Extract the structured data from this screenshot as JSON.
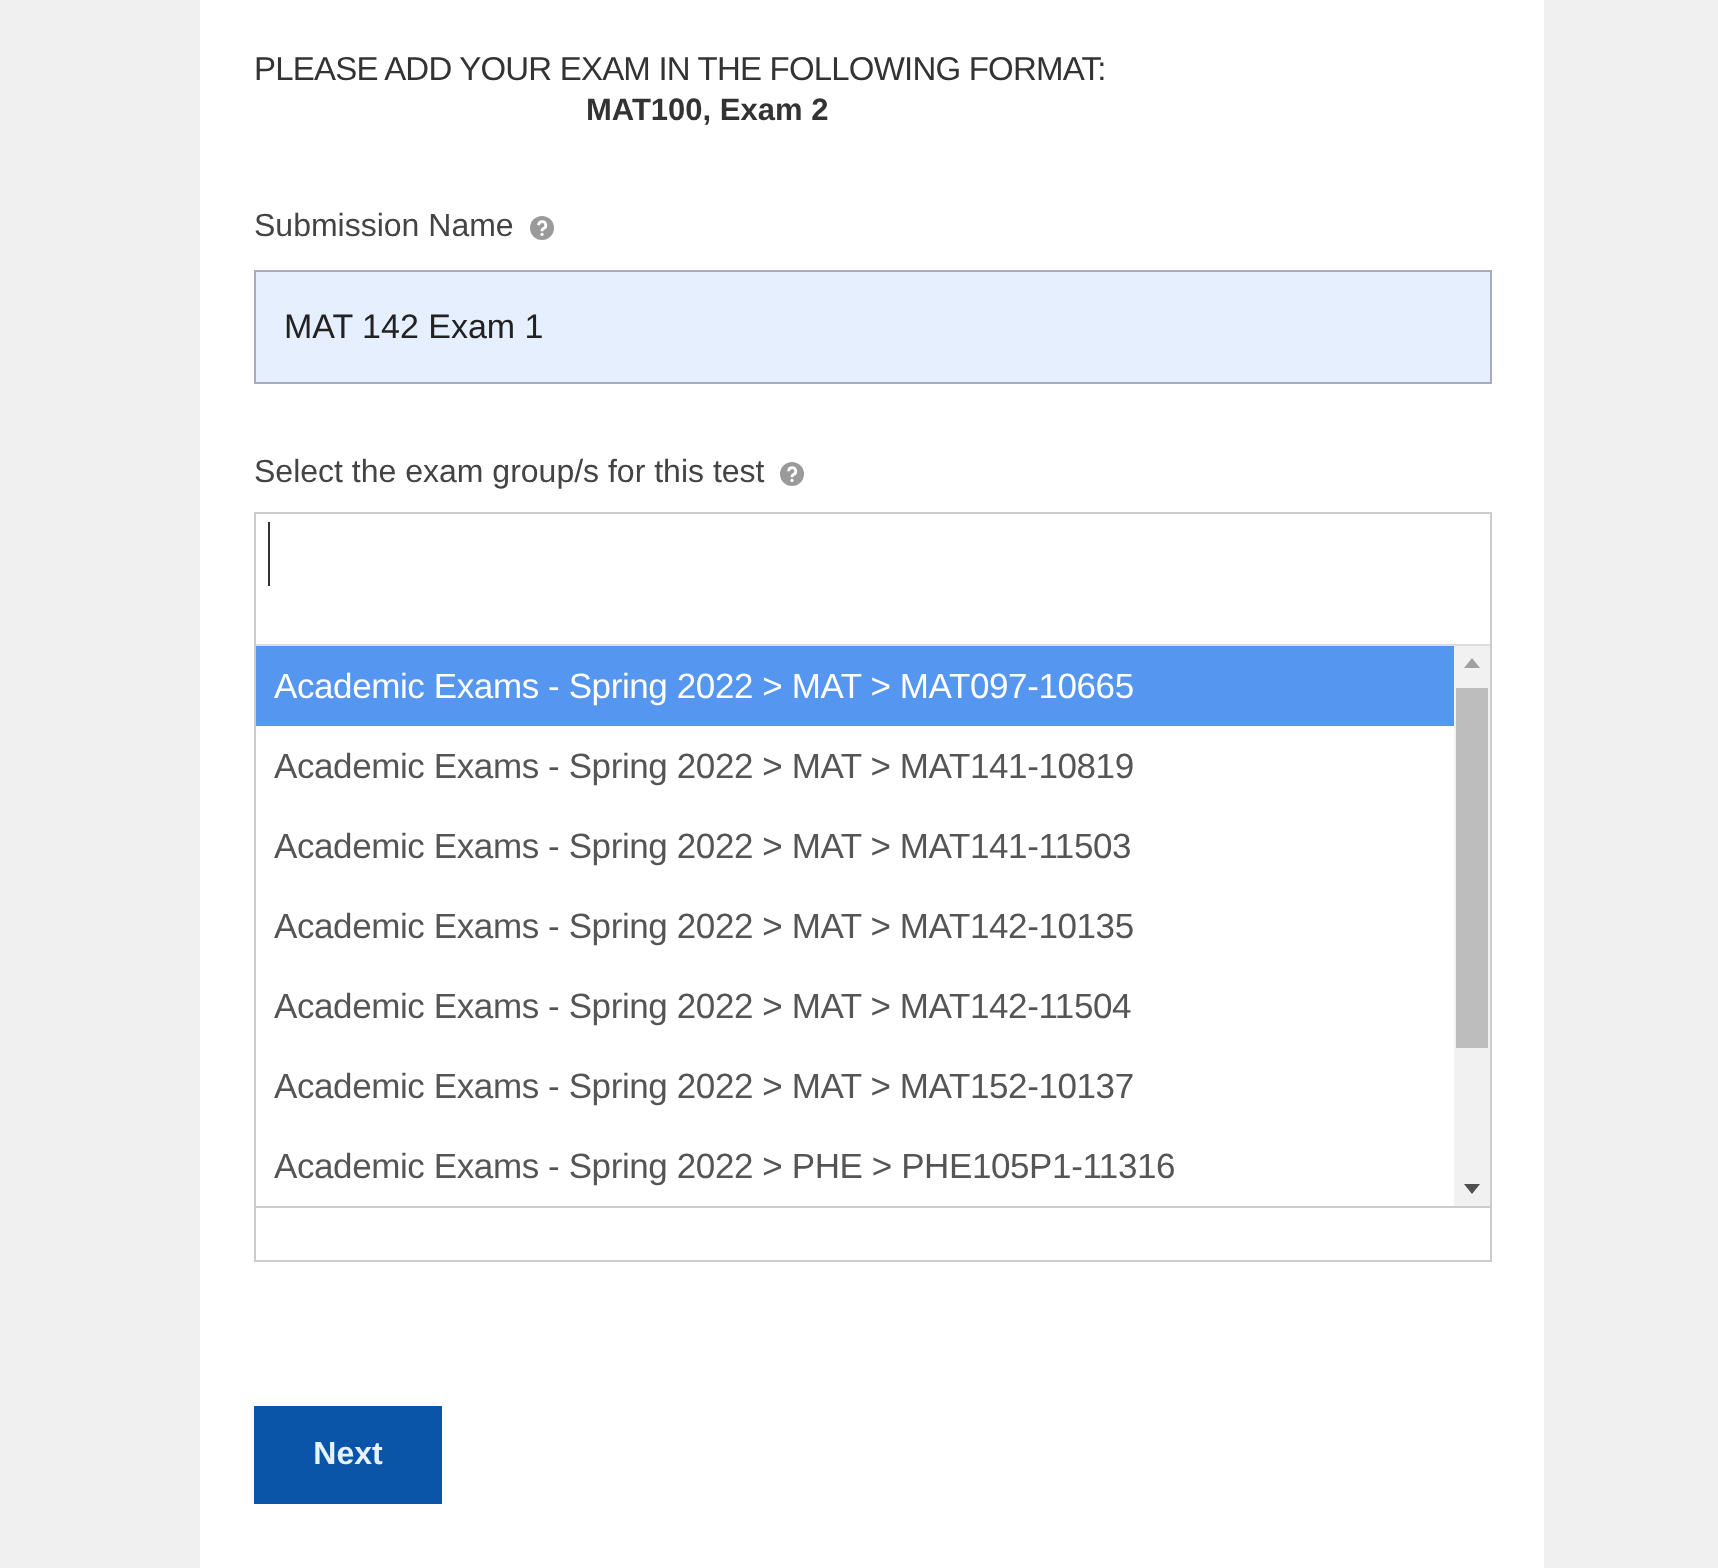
{
  "instructions": {
    "line": "PLEASE ADD YOUR EXAM IN THE FOLLOWING FORMAT:",
    "example": "MAT100, Exam 2"
  },
  "submission_name": {
    "label": "Submission Name",
    "value": "MAT 142 Exam 1"
  },
  "exam_groups": {
    "label": "Select the exam group/s for this test",
    "options": [
      {
        "label": "Academic Exams - Spring 2022 > MAT > MAT097-10665",
        "selected": true
      },
      {
        "label": "Academic Exams - Spring 2022 > MAT > MAT141-10819",
        "selected": false
      },
      {
        "label": "Academic Exams - Spring 2022 > MAT > MAT141-11503",
        "selected": false
      },
      {
        "label": "Academic Exams - Spring 2022 > MAT > MAT142-10135",
        "selected": false
      },
      {
        "label": "Academic Exams - Spring 2022 > MAT > MAT142-11504",
        "selected": false
      },
      {
        "label": "Academic Exams - Spring 2022 > MAT > MAT152-10137",
        "selected": false
      },
      {
        "label": "Academic Exams - Spring 2022 > PHE > PHE105P1-11316",
        "selected": false
      }
    ]
  },
  "buttons": [
    {
      "label": "Next"
    }
  ]
}
